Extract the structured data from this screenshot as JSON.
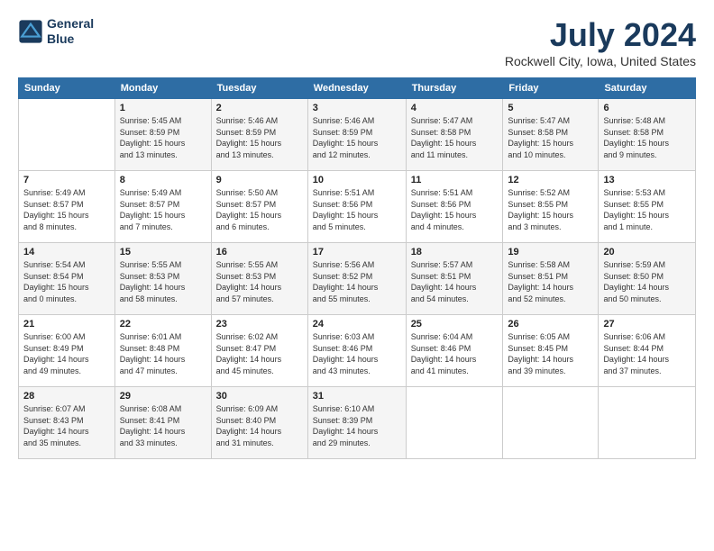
{
  "header": {
    "logo_line1": "General",
    "logo_line2": "Blue",
    "title": "July 2024",
    "location": "Rockwell City, Iowa, United States"
  },
  "weekdays": [
    "Sunday",
    "Monday",
    "Tuesday",
    "Wednesday",
    "Thursday",
    "Friday",
    "Saturday"
  ],
  "weeks": [
    [
      {
        "day": "",
        "info": ""
      },
      {
        "day": "1",
        "info": "Sunrise: 5:45 AM\nSunset: 8:59 PM\nDaylight: 15 hours\nand 13 minutes."
      },
      {
        "day": "2",
        "info": "Sunrise: 5:46 AM\nSunset: 8:59 PM\nDaylight: 15 hours\nand 13 minutes."
      },
      {
        "day": "3",
        "info": "Sunrise: 5:46 AM\nSunset: 8:59 PM\nDaylight: 15 hours\nand 12 minutes."
      },
      {
        "day": "4",
        "info": "Sunrise: 5:47 AM\nSunset: 8:58 PM\nDaylight: 15 hours\nand 11 minutes."
      },
      {
        "day": "5",
        "info": "Sunrise: 5:47 AM\nSunset: 8:58 PM\nDaylight: 15 hours\nand 10 minutes."
      },
      {
        "day": "6",
        "info": "Sunrise: 5:48 AM\nSunset: 8:58 PM\nDaylight: 15 hours\nand 9 minutes."
      }
    ],
    [
      {
        "day": "7",
        "info": "Sunrise: 5:49 AM\nSunset: 8:57 PM\nDaylight: 15 hours\nand 8 minutes."
      },
      {
        "day": "8",
        "info": "Sunrise: 5:49 AM\nSunset: 8:57 PM\nDaylight: 15 hours\nand 7 minutes."
      },
      {
        "day": "9",
        "info": "Sunrise: 5:50 AM\nSunset: 8:57 PM\nDaylight: 15 hours\nand 6 minutes."
      },
      {
        "day": "10",
        "info": "Sunrise: 5:51 AM\nSunset: 8:56 PM\nDaylight: 15 hours\nand 5 minutes."
      },
      {
        "day": "11",
        "info": "Sunrise: 5:51 AM\nSunset: 8:56 PM\nDaylight: 15 hours\nand 4 minutes."
      },
      {
        "day": "12",
        "info": "Sunrise: 5:52 AM\nSunset: 8:55 PM\nDaylight: 15 hours\nand 3 minutes."
      },
      {
        "day": "13",
        "info": "Sunrise: 5:53 AM\nSunset: 8:55 PM\nDaylight: 15 hours\nand 1 minute."
      }
    ],
    [
      {
        "day": "14",
        "info": "Sunrise: 5:54 AM\nSunset: 8:54 PM\nDaylight: 15 hours\nand 0 minutes."
      },
      {
        "day": "15",
        "info": "Sunrise: 5:55 AM\nSunset: 8:53 PM\nDaylight: 14 hours\nand 58 minutes."
      },
      {
        "day": "16",
        "info": "Sunrise: 5:55 AM\nSunset: 8:53 PM\nDaylight: 14 hours\nand 57 minutes."
      },
      {
        "day": "17",
        "info": "Sunrise: 5:56 AM\nSunset: 8:52 PM\nDaylight: 14 hours\nand 55 minutes."
      },
      {
        "day": "18",
        "info": "Sunrise: 5:57 AM\nSunset: 8:51 PM\nDaylight: 14 hours\nand 54 minutes."
      },
      {
        "day": "19",
        "info": "Sunrise: 5:58 AM\nSunset: 8:51 PM\nDaylight: 14 hours\nand 52 minutes."
      },
      {
        "day": "20",
        "info": "Sunrise: 5:59 AM\nSunset: 8:50 PM\nDaylight: 14 hours\nand 50 minutes."
      }
    ],
    [
      {
        "day": "21",
        "info": "Sunrise: 6:00 AM\nSunset: 8:49 PM\nDaylight: 14 hours\nand 49 minutes."
      },
      {
        "day": "22",
        "info": "Sunrise: 6:01 AM\nSunset: 8:48 PM\nDaylight: 14 hours\nand 47 minutes."
      },
      {
        "day": "23",
        "info": "Sunrise: 6:02 AM\nSunset: 8:47 PM\nDaylight: 14 hours\nand 45 minutes."
      },
      {
        "day": "24",
        "info": "Sunrise: 6:03 AM\nSunset: 8:46 PM\nDaylight: 14 hours\nand 43 minutes."
      },
      {
        "day": "25",
        "info": "Sunrise: 6:04 AM\nSunset: 8:46 PM\nDaylight: 14 hours\nand 41 minutes."
      },
      {
        "day": "26",
        "info": "Sunrise: 6:05 AM\nSunset: 8:45 PM\nDaylight: 14 hours\nand 39 minutes."
      },
      {
        "day": "27",
        "info": "Sunrise: 6:06 AM\nSunset: 8:44 PM\nDaylight: 14 hours\nand 37 minutes."
      }
    ],
    [
      {
        "day": "28",
        "info": "Sunrise: 6:07 AM\nSunset: 8:43 PM\nDaylight: 14 hours\nand 35 minutes."
      },
      {
        "day": "29",
        "info": "Sunrise: 6:08 AM\nSunset: 8:41 PM\nDaylight: 14 hours\nand 33 minutes."
      },
      {
        "day": "30",
        "info": "Sunrise: 6:09 AM\nSunset: 8:40 PM\nDaylight: 14 hours\nand 31 minutes."
      },
      {
        "day": "31",
        "info": "Sunrise: 6:10 AM\nSunset: 8:39 PM\nDaylight: 14 hours\nand 29 minutes."
      },
      {
        "day": "",
        "info": ""
      },
      {
        "day": "",
        "info": ""
      },
      {
        "day": "",
        "info": ""
      }
    ]
  ]
}
